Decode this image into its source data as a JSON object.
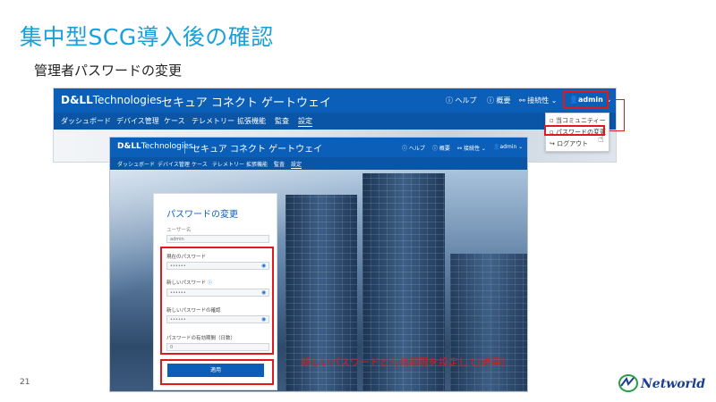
{
  "slide": {
    "title": "集中型SCG導入後の確認",
    "subtitle": "管理者パスワードの変更",
    "page_number": "21",
    "annotation": "新しいパスワードと有効期限を設定して[適用]",
    "logo_text": "Networld"
  },
  "app": {
    "brand_bold": "D&LL",
    "brand_rest": "Technologies",
    "title": "セキュア コネクト ゲートウェイ",
    "header": {
      "help": "ヘルプ",
      "overview": "概要",
      "connectivity": "接続性",
      "user": "admin"
    },
    "nav": [
      "ダッシュボード",
      "デバイス管理",
      "ケース",
      "テレメトリー",
      "拡張機能",
      "監査",
      "設定"
    ],
    "user_menu": [
      "当コミュニティー",
      "パスワードの変更",
      "ログアウト"
    ]
  },
  "form": {
    "title": "パスワードの変更",
    "username_label": "ユーザー名",
    "username_value": "admin",
    "current_label": "現在のパスワード",
    "current_value": "••••••",
    "new_label": "新しいパスワード",
    "new_value": "••••••",
    "confirm_label": "新しいパスワードの確認",
    "confirm_value": "••••••",
    "expiry_label": "パスワードの有効期間（日数）",
    "expiry_value": "0",
    "apply": "適用"
  },
  "colors": {
    "accent": "#1aa0d8",
    "header_blue": "#0b5fb8",
    "highlight_red": "#e01a1a"
  }
}
